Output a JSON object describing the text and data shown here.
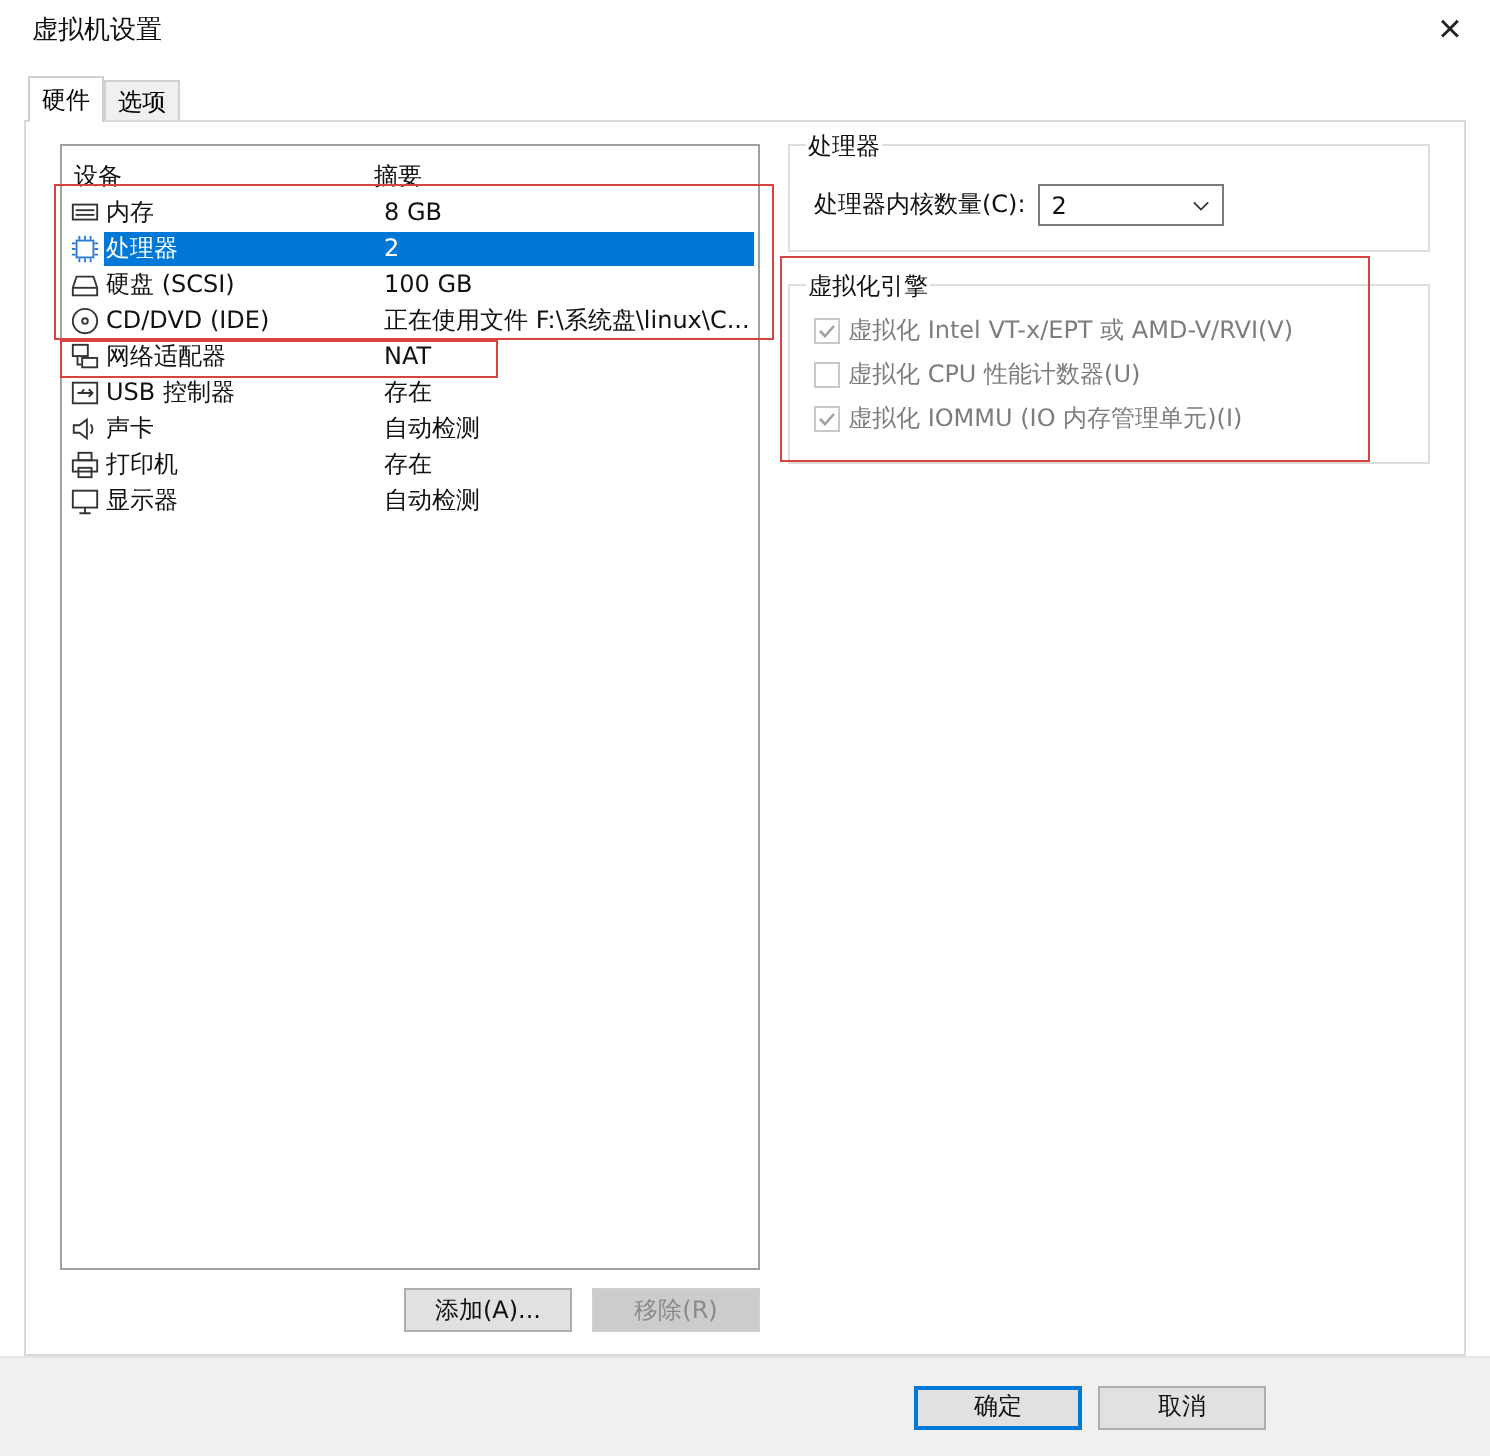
{
  "window": {
    "title": "虚拟机设置",
    "close": "×"
  },
  "tabs": [
    {
      "label": "硬件",
      "selected": true
    },
    {
      "label": "选项",
      "selected": false
    }
  ],
  "device_list": {
    "columns": [
      "设备",
      "摘要"
    ],
    "rows": [
      {
        "kind": "memory",
        "device": "内存",
        "summary": "8 GB",
        "selected": false
      },
      {
        "kind": "cpu",
        "device": "处理器",
        "summary": "2",
        "selected": true
      },
      {
        "kind": "disk",
        "device": "硬盘 (SCSI)",
        "summary": "100 GB",
        "selected": false
      },
      {
        "kind": "cd",
        "device": "CD/DVD (IDE)",
        "summary": "正在使用文件 F:\\系统盘\\linux\\C...",
        "selected": false
      },
      {
        "kind": "network",
        "device": "网络适配器",
        "summary": "NAT",
        "selected": false
      },
      {
        "kind": "usb",
        "device": "USB 控制器",
        "summary": "存在",
        "selected": false
      },
      {
        "kind": "sound",
        "device": "声卡",
        "summary": "自动检测",
        "selected": false
      },
      {
        "kind": "printer",
        "device": "打印机",
        "summary": "存在",
        "selected": false
      },
      {
        "kind": "display",
        "device": "显示器",
        "summary": "自动检测",
        "selected": false
      }
    ],
    "buttons": [
      {
        "label": "添加(A)...",
        "disabled": false
      },
      {
        "label": "移除(R)",
        "disabled": true
      }
    ]
  },
  "processor": {
    "title": "处理器",
    "cores_label": "处理器内核数量(C):",
    "cores_value": "2"
  },
  "virtualization": {
    "title": "虚拟化引擎",
    "options": [
      {
        "label": "虚拟化 Intel VT-x/EPT 或 AMD-V/RVI(V)",
        "checked": true,
        "disabled": true
      },
      {
        "label": "虚拟化 CPU 性能计数器(U)",
        "checked": false,
        "disabled": true
      },
      {
        "label": "虚拟化 IOMMU (IO 内存管理单元)(I)",
        "checked": true,
        "disabled": true
      }
    ]
  },
  "footer_buttons": [
    {
      "label": "确定",
      "default": true
    },
    {
      "label": "取消",
      "default": false
    }
  ]
}
